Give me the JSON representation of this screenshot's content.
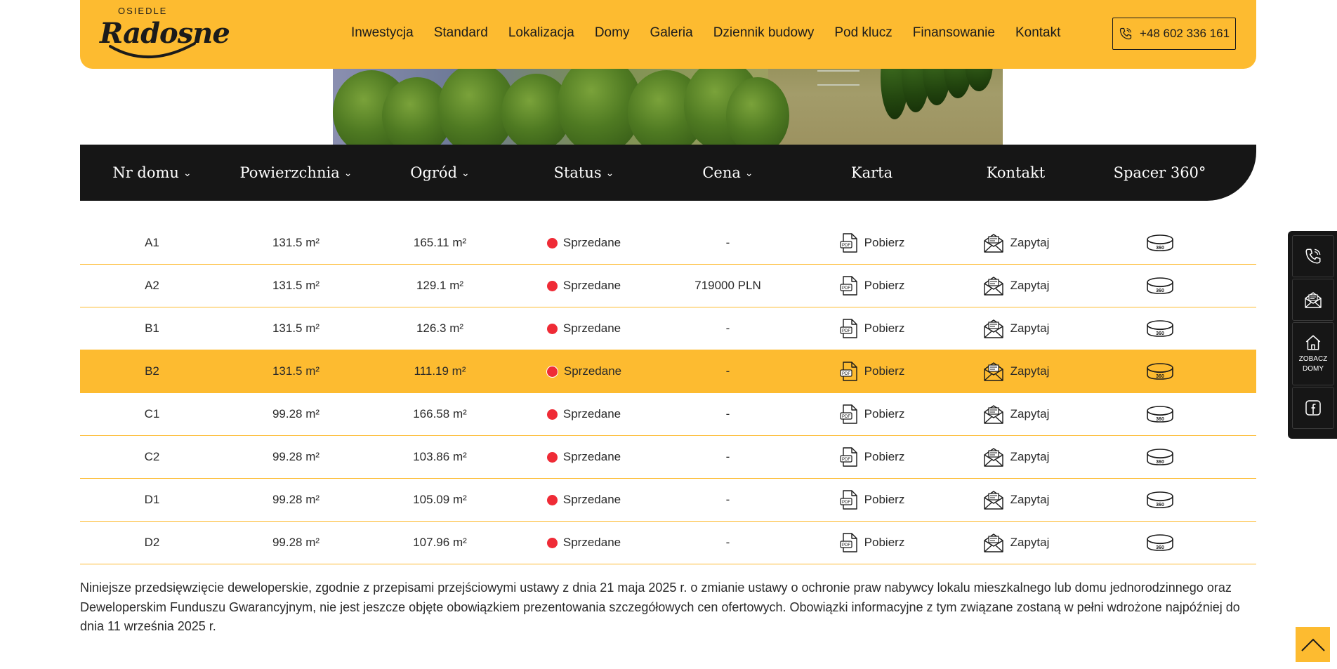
{
  "brand": {
    "small": "OSIEDLE",
    "name": "Radosne"
  },
  "nav": [
    "Inwestycja",
    "Standard",
    "Lokalizacja",
    "Domy",
    "Galeria",
    "Dziennik budowy",
    "Pod klucz",
    "Finansowanie",
    "Kontakt"
  ],
  "phone": "+48 602 336 161",
  "table": {
    "headers": [
      "Nr domu",
      "Powierzchnia",
      "Ogród",
      "Status",
      "Cena",
      "Karta",
      "Kontakt",
      "Spacer 360°"
    ],
    "rows": [
      {
        "nr": "A1",
        "area": "131.5 m²",
        "garden": "165.11 m²",
        "status": "Sprzedane",
        "price": "-",
        "card": "Pobierz",
        "contact": "Zapytaj"
      },
      {
        "nr": "A2",
        "area": "131.5 m²",
        "garden": "129.1 m²",
        "status": "Sprzedane",
        "price": "719000 PLN",
        "card": "Pobierz",
        "contact": "Zapytaj"
      },
      {
        "nr": "B1",
        "area": "131.5 m²",
        "garden": "126.3 m²",
        "status": "Sprzedane",
        "price": "-",
        "card": "Pobierz",
        "contact": "Zapytaj"
      },
      {
        "nr": "B2",
        "area": "131.5 m²",
        "garden": "111.19 m²",
        "status": "Sprzedane",
        "price": "-",
        "card": "Pobierz",
        "contact": "Zapytaj"
      },
      {
        "nr": "C1",
        "area": "99.28 m²",
        "garden": "166.58 m²",
        "status": "Sprzedane",
        "price": "-",
        "card": "Pobierz",
        "contact": "Zapytaj"
      },
      {
        "nr": "C2",
        "area": "99.28 m²",
        "garden": "103.86 m²",
        "status": "Sprzedane",
        "price": "-",
        "card": "Pobierz",
        "contact": "Zapytaj"
      },
      {
        "nr": "D1",
        "area": "99.28 m²",
        "garden": "105.09 m²",
        "status": "Sprzedane",
        "price": "-",
        "card": "Pobierz",
        "contact": "Zapytaj"
      },
      {
        "nr": "D2",
        "area": "99.28 m²",
        "garden": "107.96 m²",
        "status": "Sprzedane",
        "price": "-",
        "card": "Pobierz",
        "contact": "Zapytaj"
      }
    ]
  },
  "notice": "Niniejsze przedsięwzięcie deweloperskie, zgodnie z przepisami przejściowymi ustawy z dnia 21 maja 2025 r. o zmianie ustawy o ochronie praw nabywcy lokalu mieszkalnego lub domu jednorodzinnego oraz Deweloperskim Funduszu Gwarancyjnym, nie jest jeszcze objęte obowiązkiem prezentowania szczegółowych cen ofertowych. Obowiązki informacyjne z tym związane zostaną w pełni wdrożone najpóźniej do dnia 11 września 2025 r.",
  "side": {
    "see_houses": "ZOBACZ DOMY"
  },
  "colors": {
    "accent": "#fdbb30",
    "dark": "#161616",
    "status_sold": "#ef2b36"
  },
  "icons": [
    "phone-icon",
    "pdf-icon",
    "mail-icon",
    "tour-360-icon",
    "home-icon",
    "facebook-icon",
    "arrow-up-icon"
  ]
}
